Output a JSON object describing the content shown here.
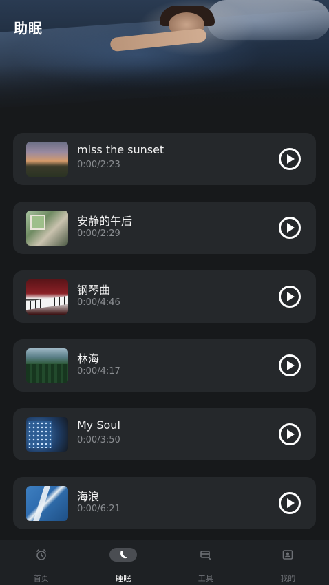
{
  "header": {
    "title": "助眠"
  },
  "tracks": [
    {
      "title": "miss the sunset",
      "time": "0:00/2:23",
      "thumb_icon": "sunset-thumbnail"
    },
    {
      "title": "安静的午后",
      "time": "0:00/2:29",
      "thumb_icon": "afternoon-room-thumbnail"
    },
    {
      "title": "钢琴曲",
      "time": "0:00/4:46",
      "thumb_icon": "piano-thumbnail"
    },
    {
      "title": "林海",
      "time": "0:00/4:17",
      "thumb_icon": "forest-thumbnail"
    },
    {
      "title": "My Soul",
      "time": "0:00/3:50",
      "thumb_icon": "night-sky-thumbnail"
    },
    {
      "title": "海浪",
      "time": "0:00/6:21",
      "thumb_icon": "ocean-waves-thumbnail"
    }
  ],
  "tabbar": {
    "items": [
      {
        "label": "首页",
        "icon": "alarm-clock-icon",
        "active": false
      },
      {
        "label": "睡眠",
        "icon": "sleep-moon-icon",
        "active": true
      },
      {
        "label": "工具",
        "icon": "tools-icon",
        "active": false
      },
      {
        "label": "我的",
        "icon": "profile-icon",
        "active": false
      }
    ]
  },
  "colors": {
    "background": "#17191b",
    "card": "#25282b",
    "tabbar": "#1e2124",
    "active_tab_pill": "#4a4d52",
    "secondary_text": "#8a8d91"
  }
}
